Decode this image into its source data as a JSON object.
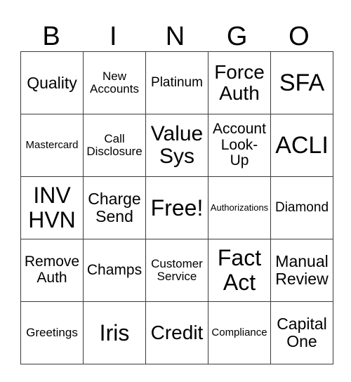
{
  "header": {
    "letters": [
      "B",
      "I",
      "N",
      "G",
      "O"
    ]
  },
  "grid": {
    "rows": [
      [
        "Quality",
        "New\nAccounts",
        "Platinum",
        "Force\nAuth",
        "SFA"
      ],
      [
        "Mastercard",
        "Call\nDisclosure",
        "Value\nSys",
        "Account\nLook-\nUp",
        "ACLI"
      ],
      [
        "INV\nHVN",
        "Charge\nSend",
        "Free!",
        "Authorizations",
        "Diamond"
      ],
      [
        "Remove\nAuth",
        "Champs",
        "Customer\nService",
        "Fact\nAct",
        "Manual\nReview"
      ],
      [
        "Greetings",
        "Iris",
        "Credit",
        "Compliance",
        "Capital\nOne"
      ]
    ],
    "free_space": "Free!"
  }
}
